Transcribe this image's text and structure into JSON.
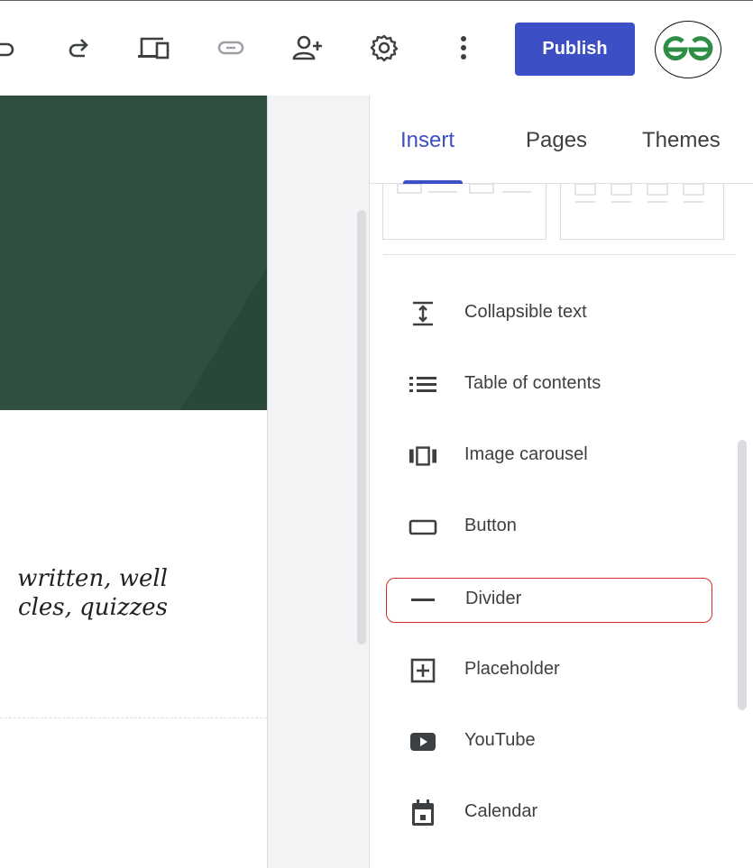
{
  "toolbar": {
    "icons": [
      "undo-icon",
      "redo-icon",
      "preview-icon",
      "link-icon",
      "share-icon",
      "settings-icon",
      "more-vert-icon"
    ],
    "publish_label": "Publish",
    "avatar_text": "ƏG",
    "avatar_color": "#2f8d46"
  },
  "canvas": {
    "hero_color": "#2f4f3f",
    "body_lines": [
      "written, well",
      "cles, quizzes"
    ]
  },
  "panel": {
    "tabs": [
      {
        "label": "Insert",
        "active": true
      },
      {
        "label": "Pages",
        "active": false
      },
      {
        "label": "Themes",
        "active": false
      }
    ],
    "accent": "#3c4fc4",
    "items": [
      {
        "label": "Collapsible text",
        "icon": "collapsible-text-icon"
      },
      {
        "label": "Table of contents",
        "icon": "table-of-contents-icon"
      },
      {
        "label": "Image carousel",
        "icon": "image-carousel-icon"
      },
      {
        "label": "Button",
        "icon": "button-icon"
      },
      {
        "label": "Divider",
        "icon": "divider-icon",
        "highlighted": true
      },
      {
        "label": "Placeholder",
        "icon": "placeholder-icon"
      },
      {
        "label": "YouTube",
        "icon": "youtube-icon"
      },
      {
        "label": "Calendar",
        "icon": "calendar-icon"
      }
    ],
    "highlight_color": "#d93025"
  }
}
